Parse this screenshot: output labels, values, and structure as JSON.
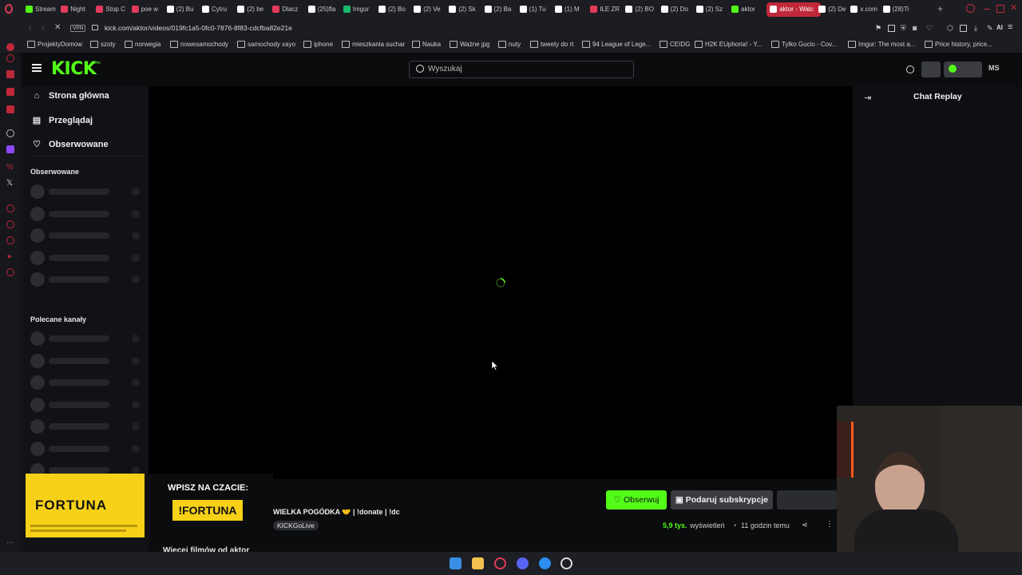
{
  "browser": {
    "tabs": [
      {
        "label": "Stream",
        "color": "#53fc18"
      },
      {
        "label": "Night",
        "color": "#e23b5b"
      },
      {
        "label": "Stop C",
        "color": "#e23b5b"
      },
      {
        "label": "poe w",
        "color": "#e23b5b"
      },
      {
        "label": "(2) Bu",
        "color": "#ffffff"
      },
      {
        "label": "Cytru",
        "color": "#ffffff"
      },
      {
        "label": "(2) be",
        "color": "#ffffff"
      },
      {
        "label": "Dlacz",
        "color": "#e23b5b"
      },
      {
        "label": "(25)fla",
        "color": "#ffffff"
      },
      {
        "label": "Imgur",
        "color": "#1bb76e"
      },
      {
        "label": "(2) Bo",
        "color": "#ffffff"
      },
      {
        "label": "(2) Ve",
        "color": "#ffffff"
      },
      {
        "label": "(2) Sk",
        "color": "#ffffff"
      },
      {
        "label": "(2) Ba",
        "color": "#ffffff"
      },
      {
        "label": "(1) Tu",
        "color": "#ffffff"
      },
      {
        "label": "(1) M",
        "color": "#ffffff"
      },
      {
        "label": "ILE ZR",
        "color": "#e23b5b"
      },
      {
        "label": "(2) BO",
        "color": "#ffffff"
      },
      {
        "label": "(2) Do",
        "color": "#ffffff"
      },
      {
        "label": "(2) Sz",
        "color": "#ffffff"
      },
      {
        "label": "aktor",
        "color": "#53fc18"
      },
      {
        "label": "aktor - Watc",
        "color": "#ffffff",
        "active": true
      },
      {
        "label": "(2) De",
        "color": "#ffffff"
      },
      {
        "label": "x.com",
        "color": "#ffffff"
      },
      {
        "label": "(28)Ti",
        "color": "#ffffff"
      }
    ],
    "vpn_label": "VPN",
    "url": "kick.com/aktor/videos/019fc1a5-0fc0-7876-8f83-cdcfba82e21e",
    "ai_label": "AI",
    "bookmarks": [
      "ProjektyDomow",
      "szoty",
      "norwegia",
      "nowesamochody",
      "samochody xayo",
      "iphone",
      "mieszkania suchar",
      "Nauka",
      "Ważne jpg",
      "nuty",
      "tweety do rt",
      "94 League of Lege...",
      "CEIDG",
      "H2K EUphoria! - Y...",
      "Tylko Gucio - Cov...",
      "Imgur: The most a...",
      "Price history, price..."
    ]
  },
  "kick": {
    "logo_text": "KICK",
    "logo_badge": "BETA",
    "search_placeholder": "Wyszukaj",
    "avatar_initials": "MS",
    "nav": [
      {
        "label": "Strona główna",
        "icon": "home-icon"
      },
      {
        "label": "Przeglądaj",
        "icon": "browse-icon"
      },
      {
        "label": "Obserwowane",
        "icon": "heart-icon"
      }
    ],
    "followed_heading": "Obserwowane",
    "recommended_heading": "Polecane kanały",
    "chat_title": "Chat Replay",
    "video": {
      "title": "WIELKA POGÓDKA 🤝 | !donate | !dc",
      "tag": "KICKGoLive",
      "follow_label": "Obserwuj",
      "gift_label": "Podaruj subskrypcje",
      "views_count": "5,9 tys.",
      "views_label": "wyświetleń",
      "time_ago": "11 godzin temu",
      "more_videos": "Więcej filmów od aktor"
    },
    "accent_color": "#53fc18"
  },
  "overlay": {
    "brand": "FORTUNA",
    "prompt": "WPISZ NA CZACIE:",
    "command": "!FORTUNA",
    "colors": {
      "yellow": "#f7d117",
      "black": "#111111"
    }
  }
}
